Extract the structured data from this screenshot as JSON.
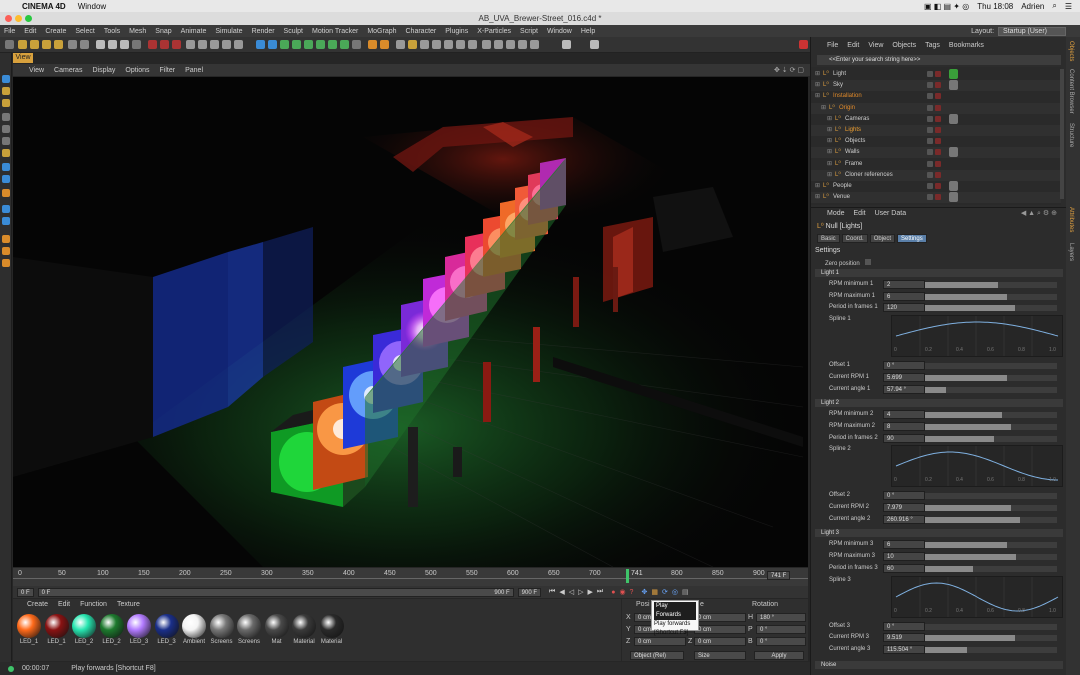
{
  "macmenu": {
    "app": "CINEMA 4D",
    "window": "Window",
    "time": "Thu 18:08",
    "user": "Adrien"
  },
  "window_title": "AB_UVA_Brewer-Street_016.c4d *",
  "menubar": {
    "items": [
      "File",
      "Edit",
      "Create",
      "Select",
      "Tools",
      "Mesh",
      "Snap",
      "Animate",
      "Simulate",
      "Render",
      "Sculpt",
      "Motion Tracker",
      "MoGraph",
      "Character",
      "Plugins",
      "X-Particles",
      "Script",
      "Window",
      "Help"
    ],
    "layout_label": "Layout:",
    "layout_value": "Startup (User)"
  },
  "viewtab": "View",
  "viewport_menu": [
    "View",
    "Cameras",
    "Display",
    "Options",
    "Filter",
    "Panel"
  ],
  "timeline": {
    "ticks": [
      "0",
      "50",
      "100",
      "150",
      "200",
      "250",
      "300",
      "350",
      "400",
      "450",
      "500",
      "550",
      "600",
      "650",
      "700",
      "750",
      "800",
      "850",
      "900"
    ],
    "current_frame": "741",
    "current_field": "741 F",
    "start": "0 F",
    "left_field": "0 F",
    "end_inner": "900 F",
    "end": "900 F"
  },
  "materials": {
    "menu": [
      "Create",
      "Edit",
      "Function",
      "Texture"
    ],
    "items": [
      {
        "name": "LED_1",
        "color": "#ff6a1a"
      },
      {
        "name": "LED_1",
        "color": "#8a1212"
      },
      {
        "name": "LED_2",
        "color": "#27e6b0"
      },
      {
        "name": "LED_2",
        "color": "#1d7a2e"
      },
      {
        "name": "LED_3",
        "color": "#b27bff"
      },
      {
        "name": "LED_3",
        "color": "#1a2f8a"
      },
      {
        "name": "Ambient",
        "color": "#f4f4f4"
      },
      {
        "name": "Screens",
        "color": "#777777"
      },
      {
        "name": "Screens",
        "color": "#6a6a6a"
      },
      {
        "name": "Mat",
        "color": "#4a4a4a"
      },
      {
        "name": "Material",
        "color": "#3a3a3a"
      },
      {
        "name": "Material",
        "color": "#2a2a2a"
      }
    ]
  },
  "coords": {
    "header_pos": "Posi",
    "header_rot": "Rotation",
    "header_size": "e",
    "rows": [
      {
        "a": "X",
        "av": "0 cm",
        "b": "",
        "bv": "0 cm",
        "c": "H",
        "cv": "180 °"
      },
      {
        "a": "Y",
        "av": "0 cm",
        "b": "",
        "bv": "0 cm",
        "c": "P",
        "cv": "0 °"
      },
      {
        "a": "Z",
        "av": "0 cm",
        "b": "Z",
        "bv": "0 cm",
        "c": "B",
        "cv": "0 °"
      }
    ],
    "mode": "Object (Rel)",
    "size": "Size",
    "apply": "Apply"
  },
  "tooltip": {
    "title": "Play Forwards",
    "line1": "Play forwards",
    "line2": "[Shortcut F8]"
  },
  "status": {
    "time": "00:00:07",
    "text": "Play forwards [Shortcut F8]"
  },
  "objmanager": {
    "menu": [
      "File",
      "Edit",
      "View",
      "Objects",
      "Tags",
      "Bookmarks"
    ],
    "search_placeholder": "<<Enter your search string here>>",
    "rows": [
      {
        "name": "Light",
        "indent": 0,
        "color": "#cfcfcf"
      },
      {
        "name": "Sky",
        "indent": 0,
        "color": "#cfcfcf"
      },
      {
        "name": "Installation",
        "indent": 0,
        "color": "#e08a2a"
      },
      {
        "name": "Origin",
        "indent": 1,
        "color": "#e08a2a"
      },
      {
        "name": "Cameras",
        "indent": 2,
        "color": "#cfcfcf"
      },
      {
        "name": "Lights",
        "indent": 2,
        "color": "#f0a030"
      },
      {
        "name": "Objects",
        "indent": 2,
        "color": "#cfcfcf"
      },
      {
        "name": "Walls",
        "indent": 2,
        "color": "#cfcfcf"
      },
      {
        "name": "Frame",
        "indent": 2,
        "color": "#cfcfcf"
      },
      {
        "name": "Cloner references",
        "indent": 2,
        "color": "#cfcfcf"
      },
      {
        "name": "People",
        "indent": 0,
        "color": "#cfcfcf"
      },
      {
        "name": "Venue",
        "indent": 0,
        "color": "#cfcfcf"
      }
    ]
  },
  "attributes": {
    "menu": [
      "Mode",
      "Edit",
      "User Data"
    ],
    "object_label": "Null [Lights]",
    "tabs": [
      "Basic",
      "Coord.",
      "Object",
      "Settings"
    ],
    "settings_title": "Settings",
    "zero_position": "Zero position",
    "lights": [
      {
        "title": "Light 1",
        "rows": [
          {
            "label": "RPM minimum 1",
            "value": "2",
            "fill": 0.55
          },
          {
            "label": "RPM maximum 1",
            "value": "6",
            "fill": 0.62
          },
          {
            "label": "Period in frames 1",
            "value": "120",
            "fill": 0.68
          }
        ],
        "spline": "Spline 1",
        "offset_label": "Offset 1",
        "offset": "0 °",
        "cur_rpm_label": "Current RPM 1",
        "cur_rpm": "5.699",
        "cur_rpm_fill": 0.62,
        "cur_angle_label": "Current angle 1",
        "cur_angle": "57.94 °",
        "cur_angle_fill": 0.16
      },
      {
        "title": "Light 2",
        "rows": [
          {
            "label": "RPM minimum 2",
            "value": "4",
            "fill": 0.58
          },
          {
            "label": "RPM maximum 2",
            "value": "8",
            "fill": 0.65
          },
          {
            "label": "Period in frames 2",
            "value": "90",
            "fill": 0.52
          }
        ],
        "spline": "Spline 2",
        "offset_label": "Offset 2",
        "offset": "0 °",
        "cur_rpm_label": "Current RPM 2",
        "cur_rpm": "7.979",
        "cur_rpm_fill": 0.65,
        "cur_angle_label": "Current angle 2",
        "cur_angle": "260.916 °",
        "cur_angle_fill": 0.72
      },
      {
        "title": "Light 3",
        "rows": [
          {
            "label": "RPM minimum 3",
            "value": "6",
            "fill": 0.62
          },
          {
            "label": "RPM maximum 3",
            "value": "10",
            "fill": 0.69
          },
          {
            "label": "Period in frames 3",
            "value": "60",
            "fill": 0.36
          }
        ],
        "spline": "Spline 3",
        "offset_label": "Offset 3",
        "offset": "0 °",
        "cur_rpm_label": "Current RPM 3",
        "cur_rpm": "9.519",
        "cur_rpm_fill": 0.68,
        "cur_angle_label": "Current angle 3",
        "cur_angle": "115.504 °",
        "cur_angle_fill": 0.32
      }
    ],
    "noise": "Noise",
    "spline_ticks": [
      "0",
      "0.2",
      "0.4",
      "0.6",
      "0.8",
      "1.0"
    ]
  },
  "side_tabs": [
    "Objects",
    "Content Browser",
    "Structure",
    "Attributes",
    "Layers"
  ]
}
